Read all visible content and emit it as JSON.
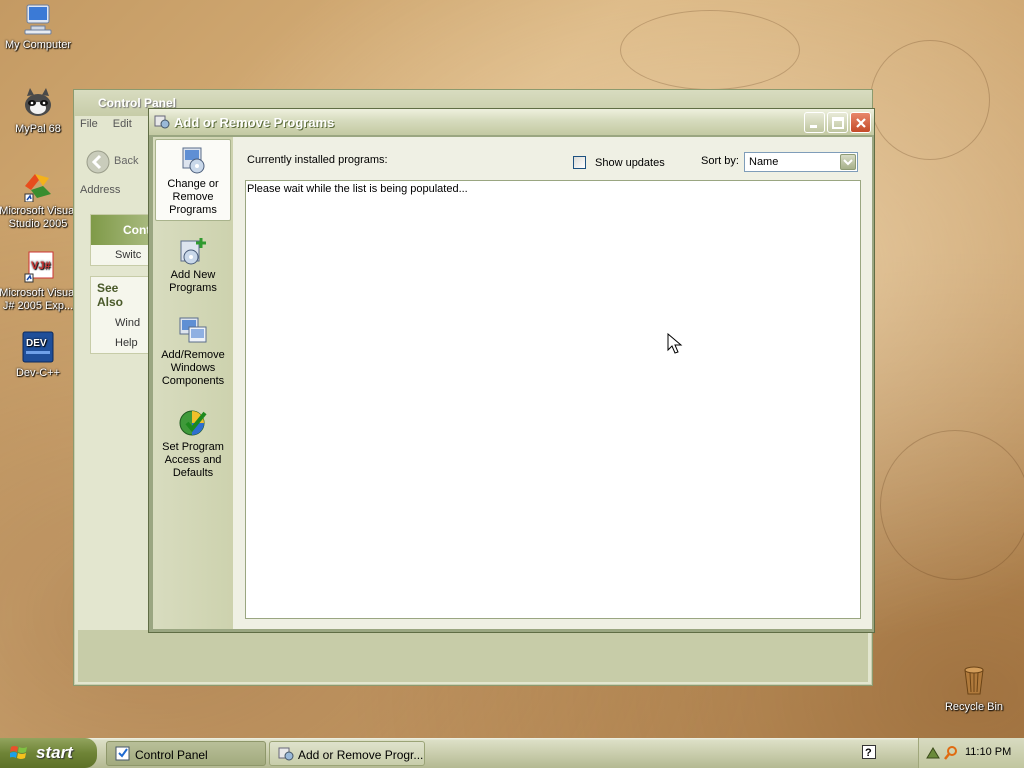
{
  "desktop": {
    "icons": [
      {
        "label": "My Computer"
      },
      {
        "label": "MyPal 68"
      },
      {
        "label": "Microsoft Visual Studio 2005"
      },
      {
        "label": "Microsoft Visual J# 2005 Exp..."
      },
      {
        "label": "Dev-C++"
      },
      {
        "label": "Recycle Bin"
      }
    ]
  },
  "control_panel": {
    "title": "Control Panel",
    "menu": {
      "file": "File",
      "edit": "Edit"
    },
    "toolbar": {
      "back": "Back"
    },
    "address_label": "Address",
    "side_header": "Cont",
    "switch_item": "Switc",
    "see_also": {
      "header": "See Also",
      "windows_item": "Wind",
      "help_item": "Help"
    }
  },
  "arp": {
    "title": "Add or Remove Programs",
    "nav": {
      "change_remove": "Change or Remove Programs",
      "add_new": "Add New Programs",
      "add_remove_windows": "Add/Remove Windows Components",
      "set_program_access": "Set Program Access and Defaults"
    },
    "installed_label": "Currently installed programs:",
    "show_updates_label": "Show updates",
    "show_updates_checked": false,
    "sort_by_label": "Sort by:",
    "sort_by_value": "Name",
    "list_message": "Please wait while the list is being populated..."
  },
  "taskbar": {
    "start_label": "start",
    "tasks": [
      {
        "label": "Control Panel"
      },
      {
        "label": "Add or Remove Progr..."
      }
    ],
    "clock": "11:10 PM"
  },
  "colors": {
    "theme": "#c3c9a2",
    "close_button": "#c44a28",
    "start_button": "#6f8437"
  }
}
